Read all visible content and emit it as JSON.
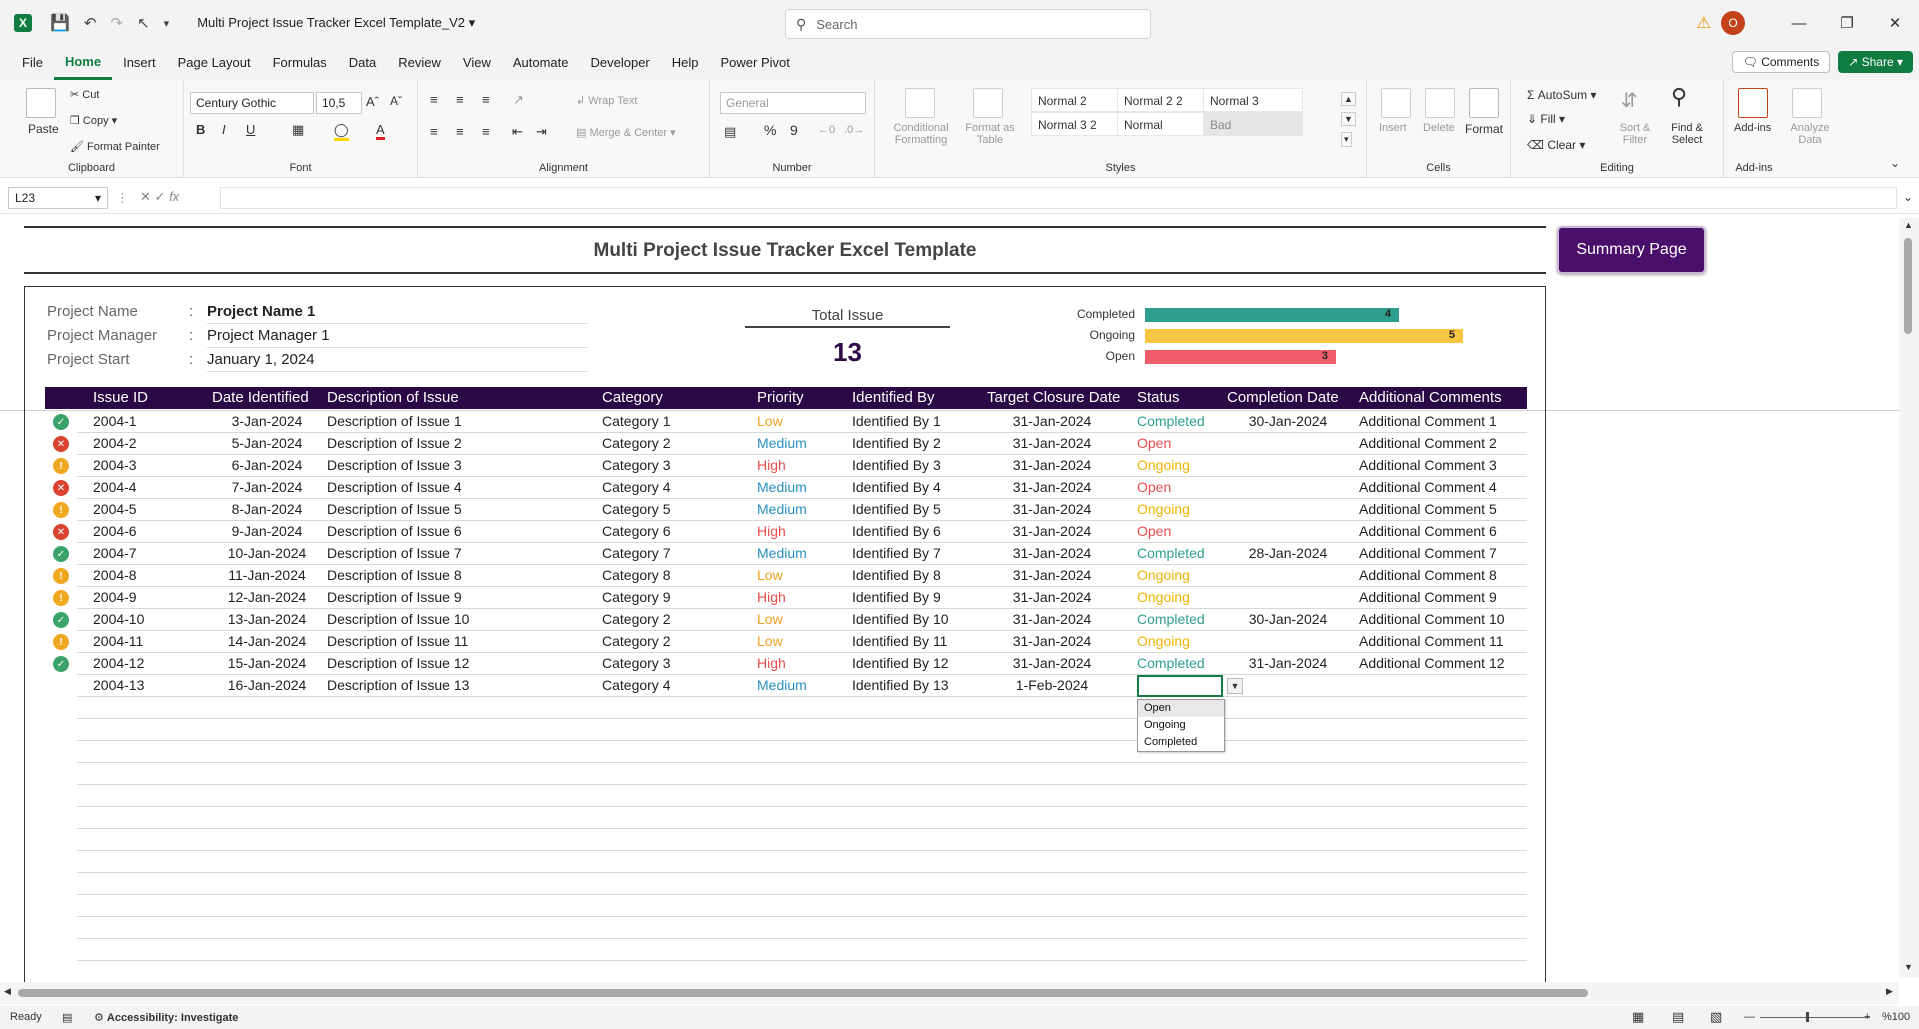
{
  "app": {
    "doc_title": "Multi Project Issue Tracker Excel Template_V2",
    "search_placeholder": "Search",
    "avatar_initial": "O"
  },
  "menu": {
    "tabs": [
      "File",
      "Home",
      "Insert",
      "Page Layout",
      "Formulas",
      "Data",
      "Review",
      "View",
      "Automate",
      "Developer",
      "Help",
      "Power Pivot"
    ],
    "active": "Home",
    "comments_label": "Comments",
    "share_label": "Share"
  },
  "ribbon": {
    "clipboard": {
      "paste": "Paste",
      "cut": "Cut",
      "copy": "Copy",
      "format_painter": "Format Painter",
      "label": "Clipboard"
    },
    "font": {
      "family": "Century Gothic",
      "size": "10,5",
      "label": "Font"
    },
    "alignment": {
      "wrap_text": "Wrap Text",
      "merge_center": "Merge & Center",
      "label": "Alignment"
    },
    "number": {
      "format": "General",
      "label": "Number"
    },
    "styles": {
      "conditional": "Conditional Formatting",
      "format_as_table": "Format as Table",
      "cells": [
        "Normal 2",
        "Normal 2 2",
        "Normal 3",
        "Normal 3 2",
        "Normal",
        "Bad"
      ],
      "label": "Styles"
    },
    "cells": {
      "insert": "Insert",
      "delete": "Delete",
      "format": "Format",
      "label": "Cells"
    },
    "editing": {
      "autosum": "AutoSum",
      "fill": "Fill",
      "clear": "Clear",
      "sort_filter": "Sort & Filter",
      "find_select": "Find & Select",
      "label": "Editing"
    },
    "addins": {
      "addins": "Add-ins",
      "analyze": "Analyze Data",
      "label": "Add-ins"
    }
  },
  "formula_bar": {
    "name_box": "L23",
    "fx": "fx",
    "value": ""
  },
  "sheet": {
    "title": "Multi Project Issue Tracker Excel Template",
    "summary_button": "Summary Page",
    "info": [
      {
        "label": "Project Name",
        "value": "Project Name 1"
      },
      {
        "label": "Project Manager",
        "value": "Project Manager 1"
      },
      {
        "label": "Project Start",
        "value": "January 1, 2024"
      }
    ],
    "colon": ":",
    "total_label": "Total Issue",
    "total_value": "13",
    "status_bars": [
      {
        "label": "Completed",
        "value": 4,
        "color": "#2e9e8f"
      },
      {
        "label": "Ongoing",
        "value": 5,
        "color": "#f7c744"
      },
      {
        "label": "Open",
        "value": 3,
        "color": "#f05d6a"
      }
    ],
    "headers": [
      "Issue ID",
      "Date Identified",
      "Description of Issue",
      "Category",
      "Priority",
      "Identified By",
      "Target Closure Date",
      "Status",
      "Completion Date",
      "Additional Comments"
    ],
    "rows": [
      {
        "icon": "ok",
        "id": "2004-1",
        "date": "3-Jan-2024",
        "desc": "Description of Issue 1",
        "cat": "Category 1",
        "prio": "Low",
        "by": "Identified By 1",
        "target": "31-Jan-2024",
        "status": "Completed",
        "comp": "30-Jan-2024",
        "comment": "Additional Comment 1"
      },
      {
        "icon": "x",
        "id": "2004-2",
        "date": "5-Jan-2024",
        "desc": "Description of Issue 2",
        "cat": "Category 2",
        "prio": "Medium",
        "by": "Identified By 2",
        "target": "31-Jan-2024",
        "status": "Open",
        "comp": "",
        "comment": "Additional Comment 2"
      },
      {
        "icon": "warn",
        "id": "2004-3",
        "date": "6-Jan-2024",
        "desc": "Description of Issue 3",
        "cat": "Category 3",
        "prio": "High",
        "by": "Identified By 3",
        "target": "31-Jan-2024",
        "status": "Ongoing",
        "comp": "",
        "comment": "Additional Comment 3"
      },
      {
        "icon": "x",
        "id": "2004-4",
        "date": "7-Jan-2024",
        "desc": "Description of Issue 4",
        "cat": "Category 4",
        "prio": "Medium",
        "by": "Identified By 4",
        "target": "31-Jan-2024",
        "status": "Open",
        "comp": "",
        "comment": "Additional Comment 4"
      },
      {
        "icon": "warn",
        "id": "2004-5",
        "date": "8-Jan-2024",
        "desc": "Description of Issue 5",
        "cat": "Category 5",
        "prio": "Medium",
        "by": "Identified By 5",
        "target": "31-Jan-2024",
        "status": "Ongoing",
        "comp": "",
        "comment": "Additional Comment 5"
      },
      {
        "icon": "x",
        "id": "2004-6",
        "date": "9-Jan-2024",
        "desc": "Description of Issue 6",
        "cat": "Category 6",
        "prio": "High",
        "by": "Identified By 6",
        "target": "31-Jan-2024",
        "status": "Open",
        "comp": "",
        "comment": "Additional Comment 6"
      },
      {
        "icon": "ok",
        "id": "2004-7",
        "date": "10-Jan-2024",
        "desc": "Description of Issue 7",
        "cat": "Category 7",
        "prio": "Medium",
        "by": "Identified By 7",
        "target": "31-Jan-2024",
        "status": "Completed",
        "comp": "28-Jan-2024",
        "comment": "Additional Comment 7"
      },
      {
        "icon": "warn",
        "id": "2004-8",
        "date": "11-Jan-2024",
        "desc": "Description of Issue 8",
        "cat": "Category 8",
        "prio": "Low",
        "by": "Identified By 8",
        "target": "31-Jan-2024",
        "status": "Ongoing",
        "comp": "",
        "comment": "Additional Comment 8"
      },
      {
        "icon": "warn",
        "id": "2004-9",
        "date": "12-Jan-2024",
        "desc": "Description of Issue 9",
        "cat": "Category 9",
        "prio": "High",
        "by": "Identified By 9",
        "target": "31-Jan-2024",
        "status": "Ongoing",
        "comp": "",
        "comment": "Additional Comment 9"
      },
      {
        "icon": "ok",
        "id": "2004-10",
        "date": "13-Jan-2024",
        "desc": "Description of Issue 10",
        "cat": "Category 2",
        "prio": "Low",
        "by": "Identified By 10",
        "target": "31-Jan-2024",
        "status": "Completed",
        "comp": "30-Jan-2024",
        "comment": "Additional Comment 10"
      },
      {
        "icon": "warn",
        "id": "2004-11",
        "date": "14-Jan-2024",
        "desc": "Description of Issue 11",
        "cat": "Category 2",
        "prio": "Low",
        "by": "Identified By 11",
        "target": "31-Jan-2024",
        "status": "Ongoing",
        "comp": "",
        "comment": "Additional Comment 11"
      },
      {
        "icon": "ok",
        "id": "2004-12",
        "date": "15-Jan-2024",
        "desc": "Description of Issue 12",
        "cat": "Category 3",
        "prio": "High",
        "by": "Identified By 12",
        "target": "31-Jan-2024",
        "status": "Completed",
        "comp": "31-Jan-2024",
        "comment": "Additional Comment 12"
      },
      {
        "icon": "",
        "id": "2004-13",
        "date": "16-Jan-2024",
        "desc": "Description of Issue 13",
        "cat": "Category 4",
        "prio": "Medium",
        "by": "Identified By 13",
        "target": "1-Feb-2024",
        "status": "",
        "comp": "",
        "comment": ""
      }
    ],
    "dropdown_options": [
      "Open",
      "Ongoing",
      "Completed"
    ],
    "dropdown_selected": "Open"
  },
  "colors": {
    "header_bg": "#2a0845",
    "prio_low": "#f0a020",
    "prio_medium": "#2a8fc0",
    "prio_high": "#e84c4c",
    "status_completed": "#2e9e8f",
    "status_open": "#e84c4c",
    "status_ongoing": "#f0b400",
    "icon_ok": "#3aa36b",
    "icon_x": "#d9432f",
    "icon_warn": "#f0a820"
  },
  "statusbar": {
    "ready": "Ready",
    "accessibility": "Accessibility: Investigate",
    "zoom": "%100"
  }
}
